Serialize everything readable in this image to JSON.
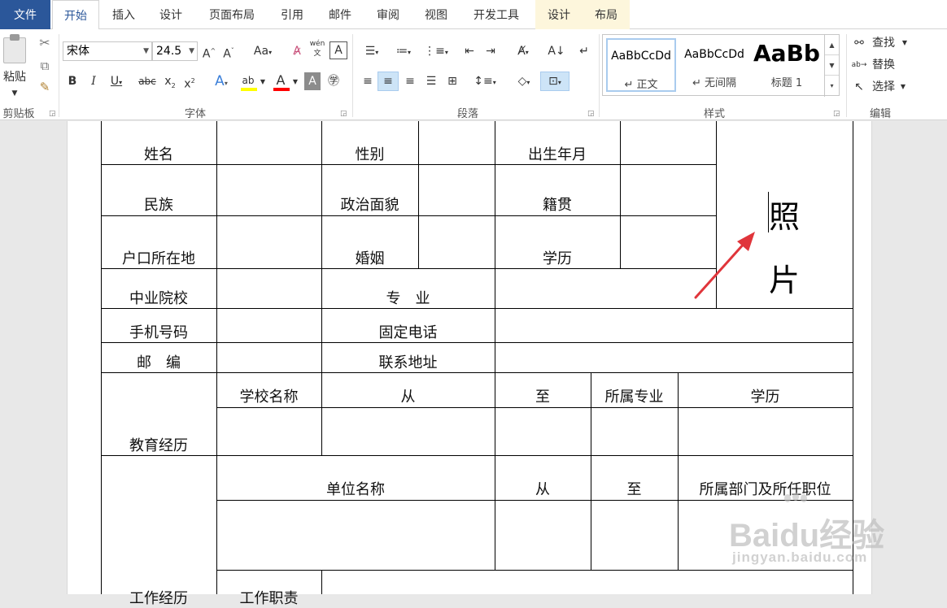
{
  "ribbon_tabs": [
    {
      "label": "文件"
    },
    {
      "label": "开始"
    },
    {
      "label": "插入"
    },
    {
      "label": "设计"
    },
    {
      "label": "页面布局"
    },
    {
      "label": "引用"
    },
    {
      "label": "邮件"
    },
    {
      "label": "审阅"
    },
    {
      "label": "视图"
    },
    {
      "label": "开发工具"
    },
    {
      "label": "设计"
    },
    {
      "label": "布局"
    }
  ],
  "clipboard": {
    "paste_label": "粘贴",
    "group_label": "剪贴板"
  },
  "font": {
    "name": "宋体",
    "size": "24.5",
    "group_label": "字体",
    "wen_glyph": "wén"
  },
  "paragraph": {
    "group_label": "段落"
  },
  "styles": {
    "group_label": "样式",
    "items": [
      {
        "sample": "AaBbCcDd",
        "name": "↵ 正文"
      },
      {
        "sample": "AaBbCcDd",
        "name": "↵ 无间隔"
      },
      {
        "sample": "AaBb",
        "name": "标题 1"
      }
    ]
  },
  "editing": {
    "find": "查找",
    "replace": "替换",
    "select": "选择",
    "group_label": "编辑"
  },
  "table": {
    "name": "姓名",
    "gender": "性别",
    "birth": "出生年月",
    "ethnicity": "民族",
    "political": "政治面貌",
    "native": "籍贯",
    "hukou": "户口所在地",
    "marriage": "婚姻",
    "education": "学历",
    "school": "中业院校",
    "major": "专　业",
    "mobile": "手机号码",
    "landline": "固定电话",
    "postcode": "邮　编",
    "address": "联系地址",
    "edu_history": "教育经历",
    "school_name": "学校名称",
    "from": "从",
    "to": "至",
    "major_belong": "所属专业",
    "degree": "学历",
    "company_name": "单位名称",
    "from2": "从",
    "to2": "至",
    "dept_position": "所属部门及所任职位",
    "work_history": "工作经历",
    "duties": "工作职责",
    "photo_1": "照",
    "photo_2": "片"
  },
  "watermark": {
    "brand": "Baidu经验",
    "url": "jingyan.baidu.com"
  },
  "colors": {
    "file_tab": "#2b579a",
    "arrow": "#e0353b",
    "highlight": "#ffff00",
    "font_color": "#ff0000"
  }
}
